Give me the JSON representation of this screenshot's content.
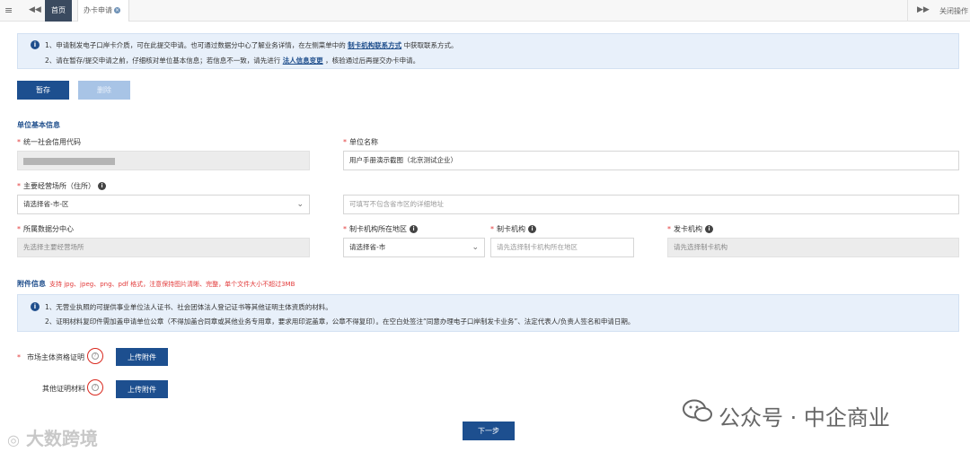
{
  "tabbar": {
    "home_tab": "首页",
    "active_tab": "办卡申请",
    "close_ops": "关闭操作"
  },
  "notice_top": {
    "line1_prefix": "1、申请制发电子口岸卡介质，可在此提交申请。也可通过数据分中心了解业务详情，在左侧菜单中的",
    "line1_link": "制卡机构联系方式",
    "line1_suffix": "中获取联系方式。",
    "line2_prefix": "2、请在暂存/提交申请之前，仔细核对单位基本信息；若信息不一致，请先进行",
    "line2_link": "法人信息变更",
    "line2_suffix": "，核验通过后再提交办卡申请。"
  },
  "actions": {
    "save_label": "暂存",
    "delete_label": "删除"
  },
  "basic_info": {
    "title": "单位基本信息",
    "credit_code_label": "统一社会信用代码",
    "company_name_label": "单位名称",
    "company_name_value": "用户手册演示截图（北京测试企业）",
    "address_label": "主要经营场所（住所）",
    "address_select_placeholder": "请选择省-市-区",
    "address_detail_placeholder": "可填写不包含省市区的详细地址",
    "data_center_label": "所属数据分中心",
    "data_center_placeholder": "先选择主要经营场所",
    "card_region_label": "制卡机构所在地区",
    "card_region_placeholder": "请选择省-市",
    "card_org_label": "制卡机构",
    "card_org_placeholder": "请先选择制卡机构所在地区",
    "issue_org_label": "发卡机构",
    "issue_org_placeholder": "请先选择制卡机构"
  },
  "attachments": {
    "title": "附件信息",
    "format_note": "支持 jpg、jpeg、png、pdf 格式，注意保持图片清晰、完整，单个文件大小不超过3MB",
    "note_line1": "1、无营业执照的可提供事业单位法人证书、社会团体法人登记证书等其他证明主体资质的材料。",
    "note_line2": "2、证明材料复印件需加盖申请单位公章（不得加盖合同章或其他业务专用章，要求用印泥盖章，公章不得复印）。在空白处签注“同意办理电子口岸制发卡业务”、法定代表人/负责人签名和申请日期。",
    "market_label": "市场主体资格证明",
    "other_label": "其他证明材料",
    "upload_label": "上传附件"
  },
  "footer": {
    "next_label": "下一步"
  },
  "watermarks": {
    "left": "大数跨境",
    "right": "公众号 · 中企商业"
  },
  "colors": {
    "primary": "#1d4f8f",
    "required": "#e23a3a",
    "notice_bg": "#e8f0fa"
  }
}
